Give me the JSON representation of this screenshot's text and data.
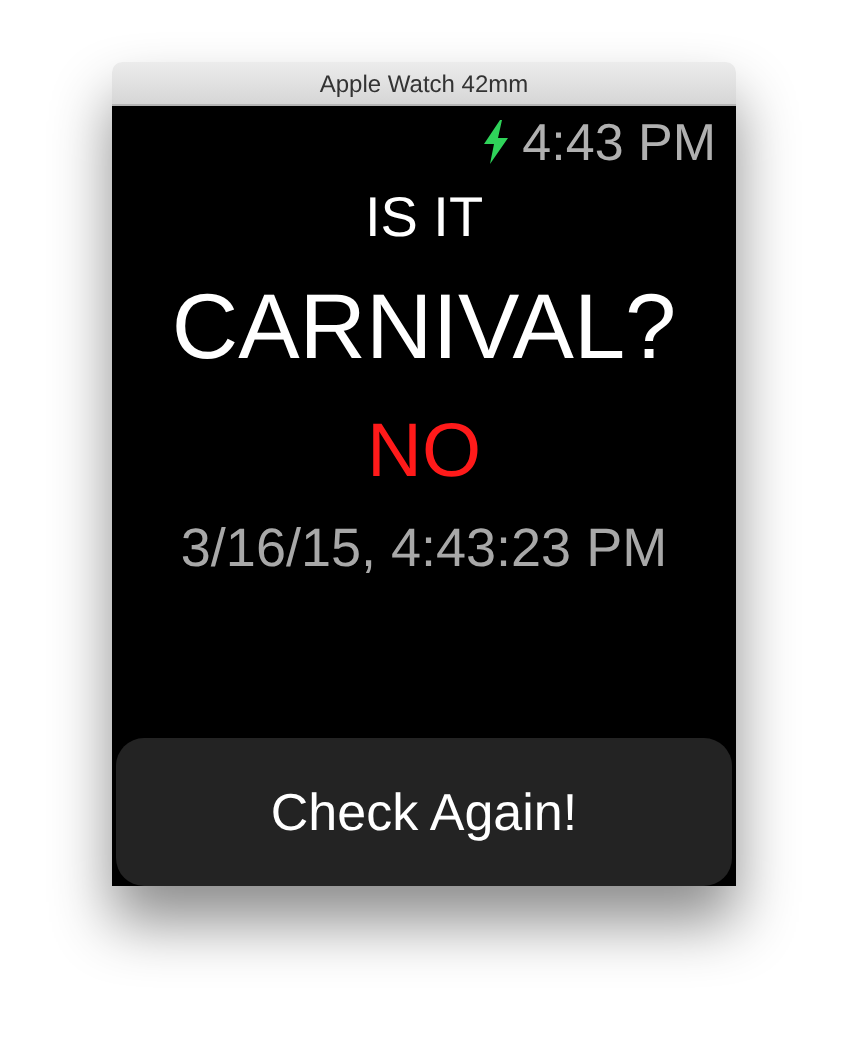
{
  "window": {
    "title": "Apple Watch 42mm"
  },
  "status_bar": {
    "time": "4:43 PM"
  },
  "question": [
    "IS IT",
    "CARNIVAL?"
  ],
  "answer": "NO",
  "timestamp": "3/16/15, 4:43:23 PM",
  "button": {
    "label": "Check Again!"
  }
}
